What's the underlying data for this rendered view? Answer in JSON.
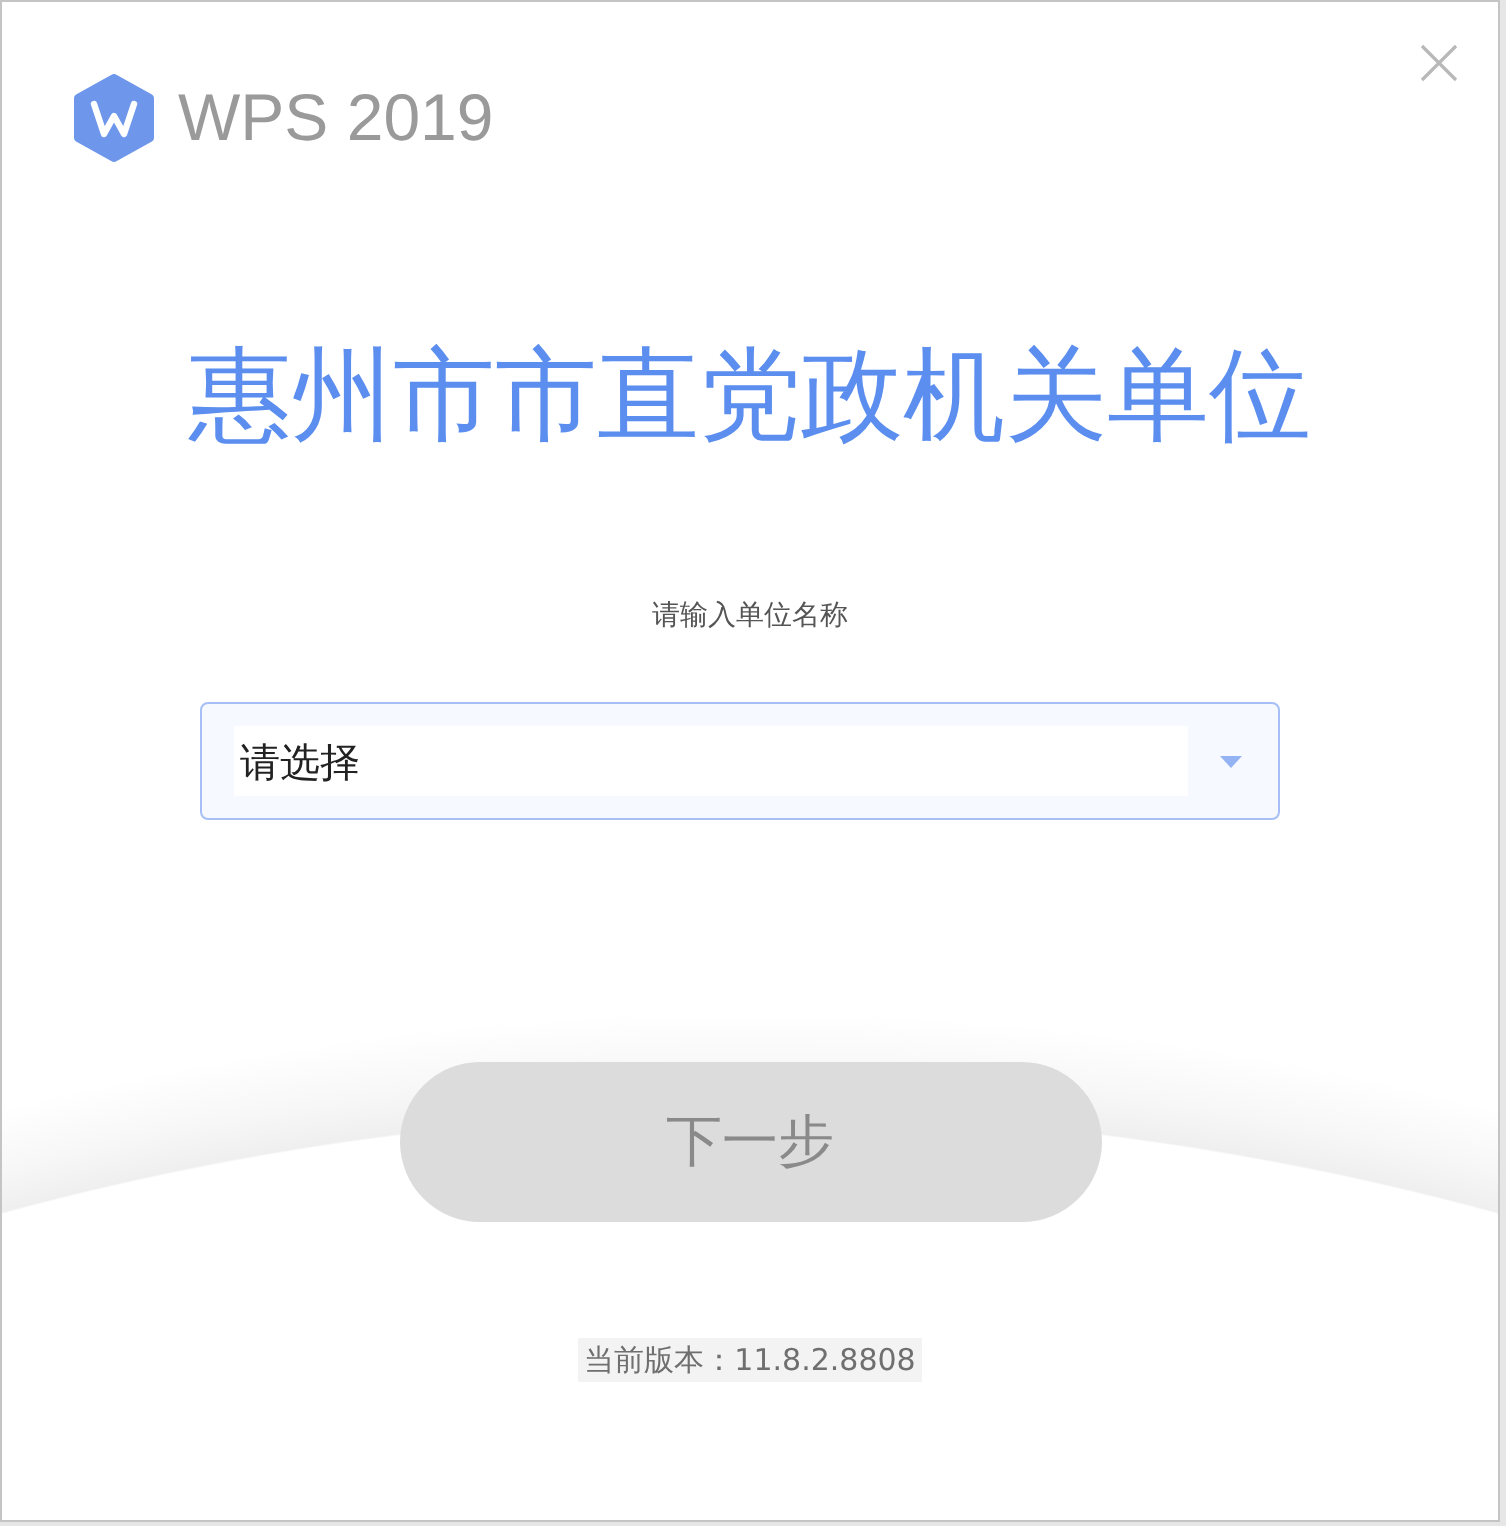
{
  "header": {
    "app_name": "WPS 2019"
  },
  "title": "惠州市市直党政机关单位",
  "unit_select": {
    "label": "请输入单位名称",
    "placeholder": "请选择"
  },
  "next_button": {
    "label": "下一步",
    "disabled": true
  },
  "version": "当前版本：11.8.2.8808"
}
